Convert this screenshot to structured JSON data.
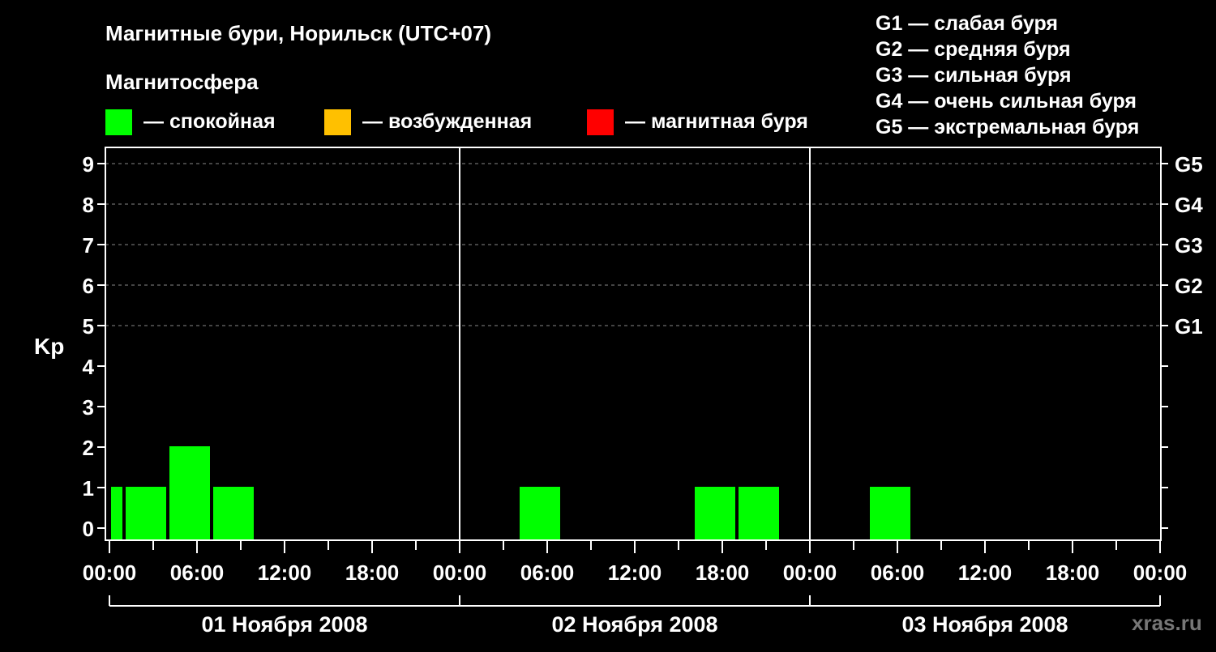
{
  "chart_data": {
    "type": "bar",
    "title": "Магнитные бури, Норильск (UTC+07)",
    "section_label": "Магнитосфера",
    "ylabel": "Kp",
    "ylim": [
      0,
      9
    ],
    "y_ticks": [
      "0",
      "1",
      "2",
      "3",
      "4",
      "5",
      "6",
      "7",
      "8",
      "9"
    ],
    "g_ticks": [
      {
        "kp": 5,
        "label": "G1"
      },
      {
        "kp": 6,
        "label": "G2"
      },
      {
        "kp": 7,
        "label": "G3"
      },
      {
        "kp": 8,
        "label": "G4"
      },
      {
        "kp": 9,
        "label": "G5"
      }
    ],
    "legend_states": [
      {
        "label": "— спокойная",
        "color": "#00ff00"
      },
      {
        "label": "— возбужденная",
        "color": "#ffc000"
      },
      {
        "label": "— магнитная буря",
        "color": "#ff0000"
      }
    ],
    "legend_storms": [
      "G1 — слабая буря",
      "G2 — средняя буря",
      "G3 — сильная буря",
      "G4 — очень сильная буря",
      "G5 — экстремальная буря"
    ],
    "x_tick_labels": [
      "00:00",
      "06:00",
      "12:00",
      "18:00",
      "00:00",
      "06:00",
      "12:00",
      "18:00",
      "00:00",
      "06:00",
      "12:00",
      "18:00",
      "00:00"
    ],
    "days": [
      "01 Ноября 2008",
      "02 Ноября 2008",
      "03 Ноября 2008"
    ],
    "bars": [
      {
        "start": "2008-11-01 00:00",
        "end": "2008-11-01 01:00",
        "kp": 1,
        "state": "спокойная"
      },
      {
        "start": "2008-11-01 01:00",
        "end": "2008-11-01 04:00",
        "kp": 1,
        "state": "спокойная"
      },
      {
        "start": "2008-11-01 04:00",
        "end": "2008-11-01 07:00",
        "kp": 2,
        "state": "спокойная"
      },
      {
        "start": "2008-11-01 07:00",
        "end": "2008-11-01 10:00",
        "kp": 1,
        "state": "спокойная"
      },
      {
        "start": "2008-11-02 04:00",
        "end": "2008-11-02 07:00",
        "kp": 1,
        "state": "спокойная"
      },
      {
        "start": "2008-11-02 16:00",
        "end": "2008-11-02 19:00",
        "kp": 1,
        "state": "спокойная"
      },
      {
        "start": "2008-11-02 19:00",
        "end": "2008-11-02 22:00",
        "kp": 1,
        "state": "спокойная"
      },
      {
        "start": "2008-11-03 04:00",
        "end": "2008-11-03 07:00",
        "kp": 1,
        "state": "спокойная"
      }
    ],
    "grid": true,
    "legend_position": "top",
    "watermark": "xras.ru"
  }
}
